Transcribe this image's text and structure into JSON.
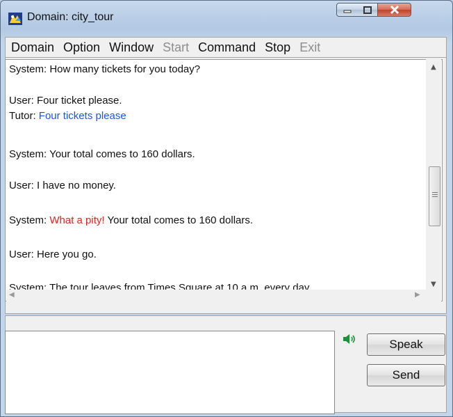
{
  "window": {
    "title": "Domain: city_tour"
  },
  "menu": [
    {
      "label": "Domain",
      "enabled": true
    },
    {
      "label": "Option",
      "enabled": true
    },
    {
      "label": "Window",
      "enabled": true
    },
    {
      "label": "Start",
      "enabled": false
    },
    {
      "label": "Command",
      "enabled": true
    },
    {
      "label": "Stop",
      "enabled": true
    },
    {
      "label": "Exit",
      "enabled": false
    }
  ],
  "dialog": {
    "line1": "System: How many tickets for you today?",
    "line2": "User: Four ticket please.",
    "line3_speaker": "Tutor:",
    "line3_text": "Four tickets please",
    "line4": "System: Your total comes to 160 dollars.",
    "line5": "User: I have no money.",
    "line6_speaker": "System:",
    "line6_highlight": "What a pity!",
    "line6_rest": "Your total comes to 160 dollars.",
    "line7": "User: Here you go.",
    "line8": "System: The tour leaves from Times Square at 10 a.m. every day."
  },
  "input": {
    "value": ""
  },
  "buttons": {
    "speak": "Speak",
    "send": "Send"
  },
  "colors": {
    "tutor_text": "#1a56e6",
    "system_highlight": "#e6231a"
  },
  "icons": {
    "app": "app-icon",
    "speaker": "speaker-icon"
  }
}
